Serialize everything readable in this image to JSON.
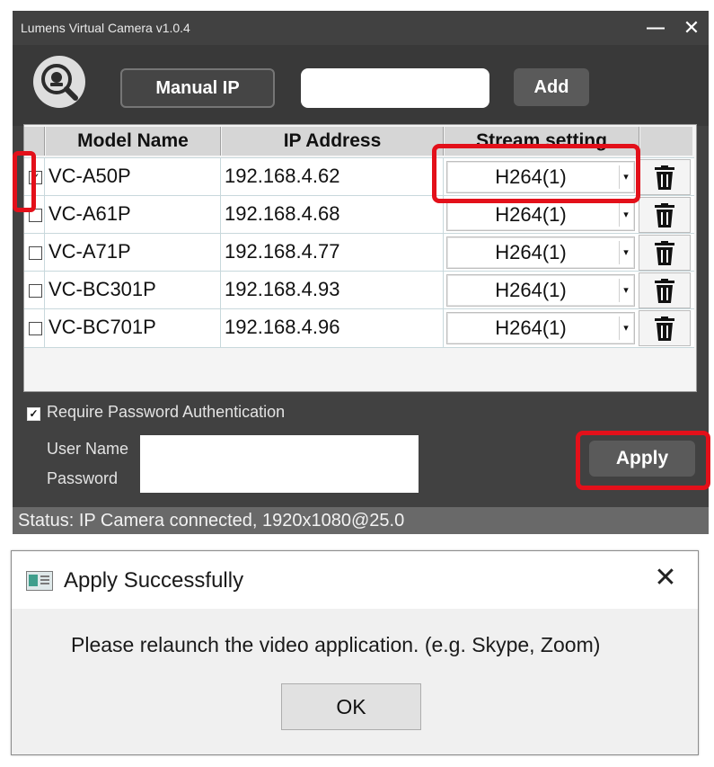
{
  "app": {
    "title": "Lumens Virtual Camera v1.0.4",
    "minimize_glyph": "—",
    "close_glyph": "✕"
  },
  "toolbar": {
    "manual_ip_label": "Manual IP",
    "ip_input_value": "",
    "add_label": "Add",
    "search_icon": "camera-search-icon"
  },
  "table": {
    "headers": {
      "model": "Model Name",
      "ip": "IP Address",
      "stream": "Stream setting"
    },
    "rows": [
      {
        "checked": true,
        "model": "VC-A50P",
        "ip": "192.168.4.62",
        "stream": "H264(1)"
      },
      {
        "checked": false,
        "model": "VC-A61P",
        "ip": "192.168.4.68",
        "stream": "H264(1)"
      },
      {
        "checked": false,
        "model": "VC-A71P",
        "ip": "192.168.4.77",
        "stream": "H264(1)"
      },
      {
        "checked": false,
        "model": "VC-BC301P",
        "ip": "192.168.4.93",
        "stream": "H264(1)"
      },
      {
        "checked": false,
        "model": "VC-BC701P",
        "ip": "192.168.4.96",
        "stream": "H264(1)"
      }
    ]
  },
  "auth": {
    "checked": true,
    "label": "Require Password Authentication",
    "username_label": "User Name",
    "password_label": "Password",
    "username_value": "",
    "password_value": ""
  },
  "apply_label": "Apply",
  "status_text": "Status: IP Camera connected, 1920x1080@25.0",
  "dialog": {
    "title": "Apply Successfully",
    "message": "Please relaunch the video application. (e.g. Skype, Zoom)",
    "ok_label": "OK",
    "close_glyph": "✕"
  },
  "colors": {
    "window_bg": "#414141",
    "highlight": "#e3101a",
    "button_dark": "#5a5a5a"
  }
}
